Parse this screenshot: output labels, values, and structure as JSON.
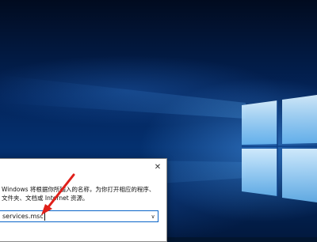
{
  "run_dialog": {
    "description_lines": [
      "Windows 将根据你所输入的名称，为你打开相应的程序、",
      "文件夹、文档或 Internet 资源。"
    ],
    "open_value": "services.msc",
    "close_symbol": "✕",
    "dropdown_symbol": "∨"
  },
  "annotation": {
    "arrow_color": "#e0201a"
  },
  "colors": {
    "logo_light": "#bfe4ff",
    "logo_glow": "#5fb2f5",
    "input_border": "#0a64c8"
  },
  "icons": [
    "windows-logo-icon",
    "close-icon",
    "dropdown-chevron-icon",
    "red-arrow-icon"
  ]
}
